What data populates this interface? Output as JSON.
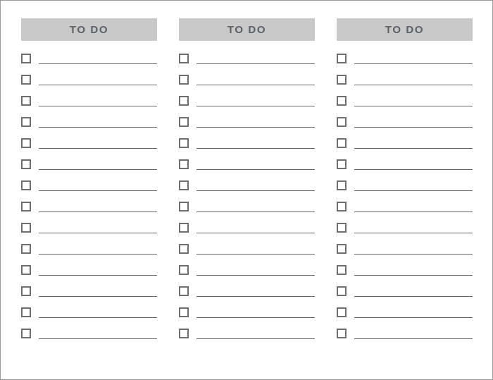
{
  "document": {
    "title": "To Do List Template",
    "background_color": "#ffffff",
    "border_color": "#9a9a9a"
  },
  "style": {
    "header_bar_color": "#c9c9c9",
    "header_text_color": "#5b5f66",
    "checkbox_border_color": "#6f6f6f",
    "line_color": "#636363"
  },
  "columns": [
    {
      "header": "TO DO",
      "row_count": 14,
      "rows": [
        {
          "checked": false,
          "text": ""
        },
        {
          "checked": false,
          "text": ""
        },
        {
          "checked": false,
          "text": ""
        },
        {
          "checked": false,
          "text": ""
        },
        {
          "checked": false,
          "text": ""
        },
        {
          "checked": false,
          "text": ""
        },
        {
          "checked": false,
          "text": ""
        },
        {
          "checked": false,
          "text": ""
        },
        {
          "checked": false,
          "text": ""
        },
        {
          "checked": false,
          "text": ""
        },
        {
          "checked": false,
          "text": ""
        },
        {
          "checked": false,
          "text": ""
        },
        {
          "checked": false,
          "text": ""
        },
        {
          "checked": false,
          "text": ""
        }
      ]
    },
    {
      "header": "TO DO",
      "row_count": 14,
      "rows": [
        {
          "checked": false,
          "text": ""
        },
        {
          "checked": false,
          "text": ""
        },
        {
          "checked": false,
          "text": ""
        },
        {
          "checked": false,
          "text": ""
        },
        {
          "checked": false,
          "text": ""
        },
        {
          "checked": false,
          "text": ""
        },
        {
          "checked": false,
          "text": ""
        },
        {
          "checked": false,
          "text": ""
        },
        {
          "checked": false,
          "text": ""
        },
        {
          "checked": false,
          "text": ""
        },
        {
          "checked": false,
          "text": ""
        },
        {
          "checked": false,
          "text": ""
        },
        {
          "checked": false,
          "text": ""
        },
        {
          "checked": false,
          "text": ""
        }
      ]
    },
    {
      "header": "TO DO",
      "row_count": 14,
      "rows": [
        {
          "checked": false,
          "text": ""
        },
        {
          "checked": false,
          "text": ""
        },
        {
          "checked": false,
          "text": ""
        },
        {
          "checked": false,
          "text": ""
        },
        {
          "checked": false,
          "text": ""
        },
        {
          "checked": false,
          "text": ""
        },
        {
          "checked": false,
          "text": ""
        },
        {
          "checked": false,
          "text": ""
        },
        {
          "checked": false,
          "text": ""
        },
        {
          "checked": false,
          "text": ""
        },
        {
          "checked": false,
          "text": ""
        },
        {
          "checked": false,
          "text": ""
        },
        {
          "checked": false,
          "text": ""
        },
        {
          "checked": false,
          "text": ""
        }
      ]
    }
  ],
  "marks": [
    {
      "label": "",
      "color": "#e8a060"
    },
    {
      "label": "",
      "color": "#7fa8d8"
    }
  ]
}
